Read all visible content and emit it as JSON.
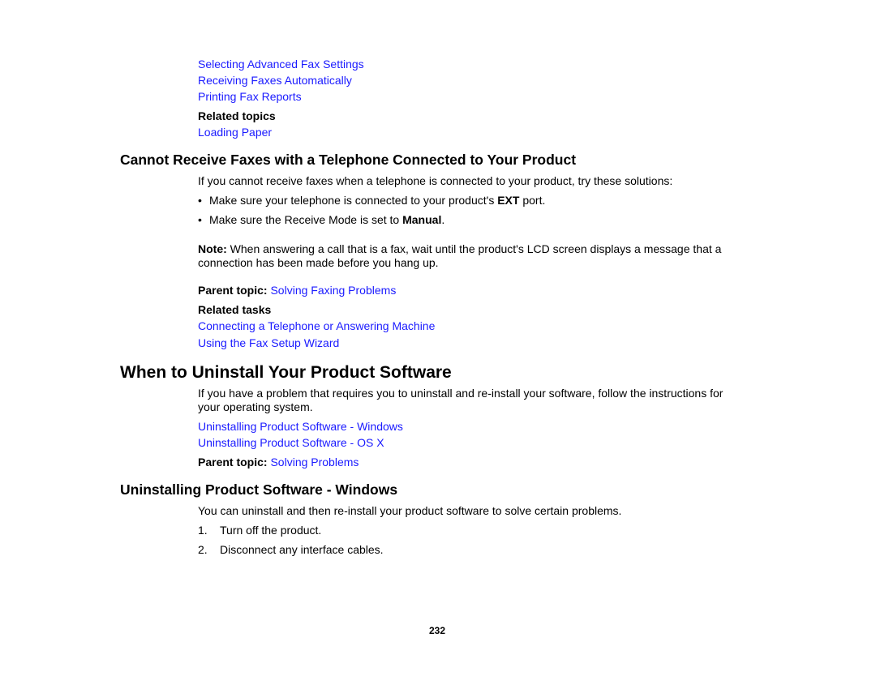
{
  "top_links": [
    "Selecting Advanced Fax Settings",
    "Receiving Faxes Automatically",
    "Printing Fax Reports"
  ],
  "related_topics": {
    "label": "Related topics",
    "links": [
      "Loading Paper"
    ]
  },
  "section1": {
    "title": "Cannot Receive Faxes with a Telephone Connected to Your Product",
    "intro": "If you cannot receive faxes when a telephone is connected to your product, try these solutions:",
    "bullets": [
      {
        "pre": "Make sure your telephone is connected to your product's ",
        "bold": "EXT",
        "post": " port."
      },
      {
        "pre": "Make sure the Receive Mode is set to ",
        "bold": "Manual",
        "post": "."
      }
    ],
    "bullet_glyph": "•",
    "note_label": "Note:",
    "note_line1": " When answering a call that is a fax, wait until the product's LCD screen displays a message that a",
    "note_line2": "connection has been made before you hang up.",
    "parent_topic_label": "Parent topic:",
    "parent_topic_link": "Solving Faxing Problems",
    "related_tasks_label": "Related tasks",
    "related_tasks": [
      "Connecting a Telephone or Answering Machine",
      "Using the Fax Setup Wizard"
    ]
  },
  "section2": {
    "title": "When to Uninstall Your Product Software",
    "intro_line1": "If you have a problem that requires you to uninstall and re-install your software, follow the instructions for",
    "intro_line2": "your operating system.",
    "links": [
      "Uninstalling Product Software - Windows",
      "Uninstalling Product Software - OS X"
    ],
    "parent_topic_label": "Parent topic:",
    "parent_topic_link": "Solving Problems"
  },
  "section3": {
    "title": "Uninstalling Product Software - Windows",
    "intro": "You can uninstall and then re-install your product software to solve certain problems.",
    "steps": [
      {
        "num": "1.",
        "text": "Turn off the product."
      },
      {
        "num": "2.",
        "text": "Disconnect any interface cables."
      }
    ]
  },
  "page_number": "232"
}
